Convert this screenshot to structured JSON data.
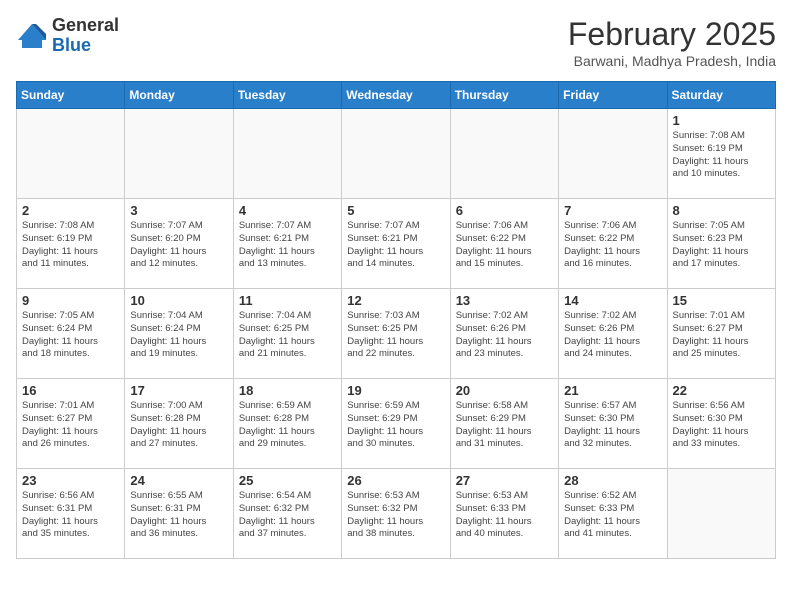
{
  "header": {
    "logo_general": "General",
    "logo_blue": "Blue",
    "month_title": "February 2025",
    "subtitle": "Barwani, Madhya Pradesh, India"
  },
  "weekdays": [
    "Sunday",
    "Monday",
    "Tuesday",
    "Wednesday",
    "Thursday",
    "Friday",
    "Saturday"
  ],
  "weeks": [
    [
      {
        "day": "",
        "info": ""
      },
      {
        "day": "",
        "info": ""
      },
      {
        "day": "",
        "info": ""
      },
      {
        "day": "",
        "info": ""
      },
      {
        "day": "",
        "info": ""
      },
      {
        "day": "",
        "info": ""
      },
      {
        "day": "1",
        "info": "Sunrise: 7:08 AM\nSunset: 6:19 PM\nDaylight: 11 hours\nand 10 minutes."
      }
    ],
    [
      {
        "day": "2",
        "info": "Sunrise: 7:08 AM\nSunset: 6:19 PM\nDaylight: 11 hours\nand 11 minutes."
      },
      {
        "day": "3",
        "info": "Sunrise: 7:07 AM\nSunset: 6:20 PM\nDaylight: 11 hours\nand 12 minutes."
      },
      {
        "day": "4",
        "info": "Sunrise: 7:07 AM\nSunset: 6:21 PM\nDaylight: 11 hours\nand 13 minutes."
      },
      {
        "day": "5",
        "info": "Sunrise: 7:07 AM\nSunset: 6:21 PM\nDaylight: 11 hours\nand 14 minutes."
      },
      {
        "day": "6",
        "info": "Sunrise: 7:06 AM\nSunset: 6:22 PM\nDaylight: 11 hours\nand 15 minutes."
      },
      {
        "day": "7",
        "info": "Sunrise: 7:06 AM\nSunset: 6:22 PM\nDaylight: 11 hours\nand 16 minutes."
      },
      {
        "day": "8",
        "info": "Sunrise: 7:05 AM\nSunset: 6:23 PM\nDaylight: 11 hours\nand 17 minutes."
      }
    ],
    [
      {
        "day": "9",
        "info": "Sunrise: 7:05 AM\nSunset: 6:24 PM\nDaylight: 11 hours\nand 18 minutes."
      },
      {
        "day": "10",
        "info": "Sunrise: 7:04 AM\nSunset: 6:24 PM\nDaylight: 11 hours\nand 19 minutes."
      },
      {
        "day": "11",
        "info": "Sunrise: 7:04 AM\nSunset: 6:25 PM\nDaylight: 11 hours\nand 21 minutes."
      },
      {
        "day": "12",
        "info": "Sunrise: 7:03 AM\nSunset: 6:25 PM\nDaylight: 11 hours\nand 22 minutes."
      },
      {
        "day": "13",
        "info": "Sunrise: 7:02 AM\nSunset: 6:26 PM\nDaylight: 11 hours\nand 23 minutes."
      },
      {
        "day": "14",
        "info": "Sunrise: 7:02 AM\nSunset: 6:26 PM\nDaylight: 11 hours\nand 24 minutes."
      },
      {
        "day": "15",
        "info": "Sunrise: 7:01 AM\nSunset: 6:27 PM\nDaylight: 11 hours\nand 25 minutes."
      }
    ],
    [
      {
        "day": "16",
        "info": "Sunrise: 7:01 AM\nSunset: 6:27 PM\nDaylight: 11 hours\nand 26 minutes."
      },
      {
        "day": "17",
        "info": "Sunrise: 7:00 AM\nSunset: 6:28 PM\nDaylight: 11 hours\nand 27 minutes."
      },
      {
        "day": "18",
        "info": "Sunrise: 6:59 AM\nSunset: 6:28 PM\nDaylight: 11 hours\nand 29 minutes."
      },
      {
        "day": "19",
        "info": "Sunrise: 6:59 AM\nSunset: 6:29 PM\nDaylight: 11 hours\nand 30 minutes."
      },
      {
        "day": "20",
        "info": "Sunrise: 6:58 AM\nSunset: 6:29 PM\nDaylight: 11 hours\nand 31 minutes."
      },
      {
        "day": "21",
        "info": "Sunrise: 6:57 AM\nSunset: 6:30 PM\nDaylight: 11 hours\nand 32 minutes."
      },
      {
        "day": "22",
        "info": "Sunrise: 6:56 AM\nSunset: 6:30 PM\nDaylight: 11 hours\nand 33 minutes."
      }
    ],
    [
      {
        "day": "23",
        "info": "Sunrise: 6:56 AM\nSunset: 6:31 PM\nDaylight: 11 hours\nand 35 minutes."
      },
      {
        "day": "24",
        "info": "Sunrise: 6:55 AM\nSunset: 6:31 PM\nDaylight: 11 hours\nand 36 minutes."
      },
      {
        "day": "25",
        "info": "Sunrise: 6:54 AM\nSunset: 6:32 PM\nDaylight: 11 hours\nand 37 minutes."
      },
      {
        "day": "26",
        "info": "Sunrise: 6:53 AM\nSunset: 6:32 PM\nDaylight: 11 hours\nand 38 minutes."
      },
      {
        "day": "27",
        "info": "Sunrise: 6:53 AM\nSunset: 6:33 PM\nDaylight: 11 hours\nand 40 minutes."
      },
      {
        "day": "28",
        "info": "Sunrise: 6:52 AM\nSunset: 6:33 PM\nDaylight: 11 hours\nand 41 minutes."
      },
      {
        "day": "",
        "info": ""
      }
    ]
  ]
}
